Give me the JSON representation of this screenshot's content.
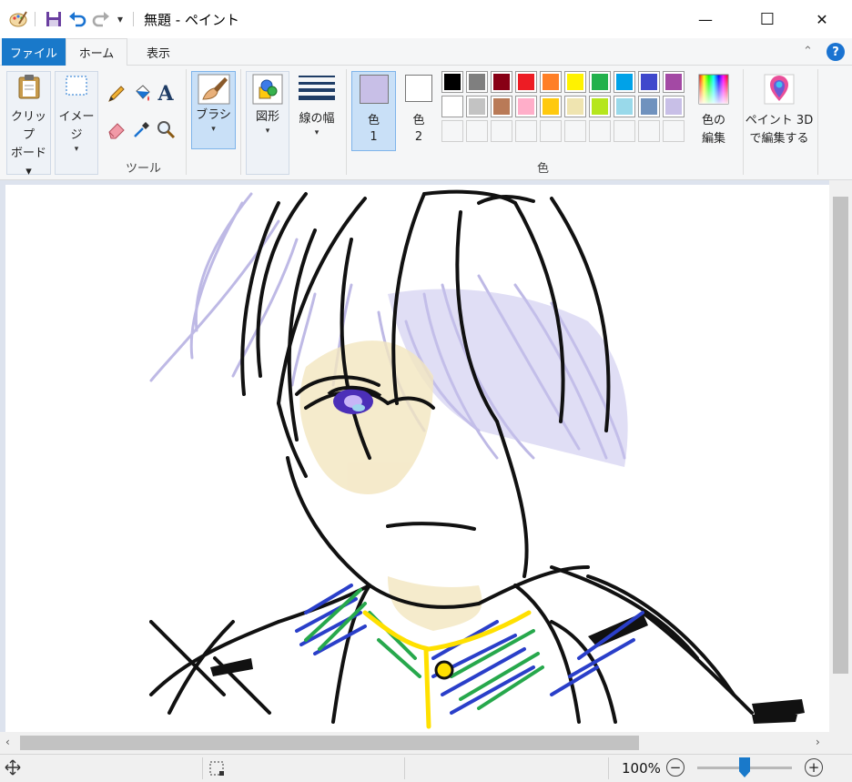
{
  "window": {
    "title": "無題 - ペイント",
    "controls": {
      "minimize": "—",
      "maximize": "☐",
      "close": "✕"
    }
  },
  "quick_access": {
    "qat_caret": "▾"
  },
  "tabs": [
    {
      "label": "ファイル",
      "active": false
    },
    {
      "label": "ホーム",
      "active": true
    },
    {
      "label": "表示",
      "active": false
    }
  ],
  "ribbon": {
    "clipboard": {
      "line1": "クリップ",
      "line2": "ボード ▾"
    },
    "image": {
      "line1": "イメージ",
      "caret": "▾"
    },
    "tools": {
      "group_label": "ツール"
    },
    "brush": {
      "label": "ブラシ",
      "caret": "▾"
    },
    "shapes": {
      "label": "図形",
      "caret": "▾"
    },
    "line_width": {
      "label": "線の幅",
      "caret": "▾"
    },
    "color1": {
      "line1": "色",
      "line2": "1",
      "value": "#c8bfe7"
    },
    "color2": {
      "line1": "色",
      "line2": "2",
      "value": "#ffffff"
    },
    "edit_colors": {
      "line1": "色の",
      "line2": "編集"
    },
    "paint3d": {
      "line1": "ペイント 3D",
      "line2": "で編集する"
    },
    "colors_group_label": "色",
    "palette_row1": [
      "#000000",
      "#7f7f7f",
      "#880015",
      "#ed1c24",
      "#ff7f27",
      "#fff200",
      "#22b14c",
      "#00a2e8",
      "#3f48cc",
      "#a349a4"
    ],
    "palette_row2": [
      "#ffffff",
      "#c3c3c3",
      "#b97a57",
      "#ffaec9",
      "#ffc90e",
      "#efe4b0",
      "#b5e61d",
      "#99d9ea",
      "#7092be",
      "#c8bfe7"
    ]
  },
  "statusbar": {
    "zoom": "100%",
    "zoom_minus": "−",
    "zoom_plus": "+",
    "zoom_level": 0.5
  }
}
